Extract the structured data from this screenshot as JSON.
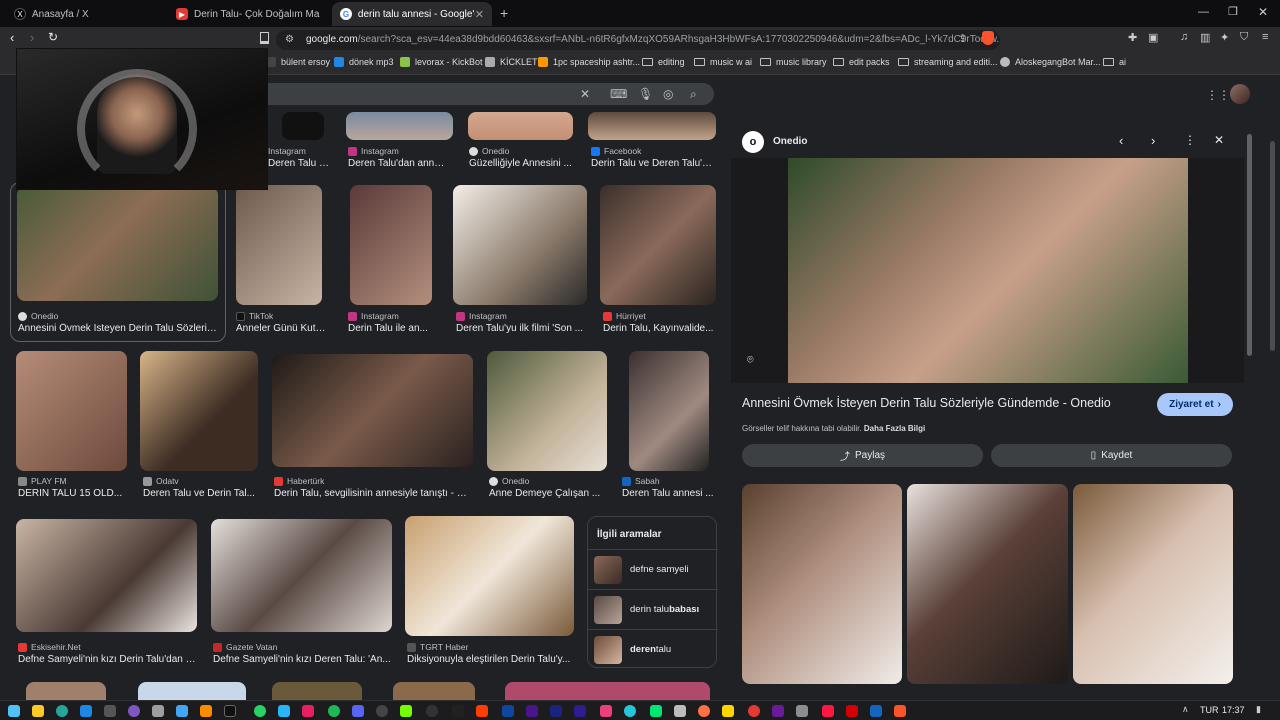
{
  "tabs": [
    {
      "title": "Anasayfa / X",
      "icon": "x-icon"
    },
    {
      "title": "Derin Talu- Çok Doğalım Makyajı - Yo",
      "icon": "youtube-icon"
    },
    {
      "title": "derin talu annesi - Google'da Ar",
      "icon": "google-icon"
    }
  ],
  "address": {
    "host": "google.com",
    "path": "/search?sca_esv=44ea38d9bdd60463&sxsrf=ANbL-n6tR6gfxMzqXO59ARhsgaH3HbWFsA:1770302250946&udm=2&fbs=ADc_l-Yk7dC9rTocjjw..."
  },
  "bookmarks": [
    {
      "label": "bülent ersoy",
      "type": "site",
      "color": "#444"
    },
    {
      "label": "dönek mp3",
      "type": "site",
      "color": "#1e88e5"
    },
    {
      "label": "levorax - KickBot",
      "type": "site",
      "color": "#8bc34a"
    },
    {
      "label": "KİCKLET",
      "type": "site",
      "color": "#aaa"
    },
    {
      "label": "1pc spaceship ashtr...",
      "type": "site",
      "color": "#ff9800"
    },
    {
      "label": "editing",
      "type": "folder"
    },
    {
      "label": "music w ai",
      "type": "folder"
    },
    {
      "label": "music library",
      "type": "folder"
    },
    {
      "label": "edit packs",
      "type": "folder"
    },
    {
      "label": "streaming and editi...",
      "type": "folder"
    },
    {
      "label": "AloskegangBot Mar...",
      "type": "site",
      "color": "#bbb"
    },
    {
      "label": "ai",
      "type": "folder"
    }
  ],
  "row0": [
    {
      "source": "Instagram",
      "title": "Deren Talu v..."
    },
    {
      "source": "Instagram",
      "title": "Deren Talu'dan anne..."
    },
    {
      "source": "Onedio",
      "title": "Güzelliğiyle Annesini ..."
    },
    {
      "source": "Facebook",
      "title": "Derin Talu ve Deren Talu'n..."
    }
  ],
  "row1": [
    {
      "source": "Onedio",
      "title": "Annesini Övmek İsteyen Derin Talu Sözleriyl..."
    },
    {
      "source": "TikTok",
      "title": "Anneler Günü Kutl..."
    },
    {
      "source": "Instagram",
      "title": "Derin Talu ile an..."
    },
    {
      "source": "Instagram",
      "title": "Deren Talu'yu ilk filmi 'Son ..."
    },
    {
      "source": "Hürriyet",
      "title": "Derin Talu, Kayınvalide..."
    }
  ],
  "row2": [
    {
      "source": "PLAY FM",
      "title": "DERİN TALU 15 OLD..."
    },
    {
      "source": "Odatv",
      "title": "Deren Talu ve Derin Tal..."
    },
    {
      "source": "Habertürk",
      "title": "Derin Talu, sevgilisinin annesiyle tanıştı - M..."
    },
    {
      "source": "Onedio",
      "title": "Anne Demeye Çalışan ..."
    },
    {
      "source": "Sabah",
      "title": "Deren Talu annesi ..."
    }
  ],
  "row3": [
    {
      "source": "Eskisehir.Net",
      "title": "Defne Samyeli'nin kızı Derin Talu'dan s..."
    },
    {
      "source": "Gazete Vatan",
      "title": "Defne Samyeli'nin kızı Deren Talu: 'An..."
    },
    {
      "source": "TGRT Haber",
      "title": "Diksiyonuyla eleştirilen Derin Talu'y..."
    }
  ],
  "related": {
    "heading": "İlgili aramalar",
    "items": [
      {
        "pre": "defne samyeli",
        "bold": ""
      },
      {
        "pre": "derin talu ",
        "bold": "babası"
      },
      {
        "pre": "",
        "bold": "deren",
        "post": " talu"
      }
    ]
  },
  "panel": {
    "site": "Onedio",
    "title": "Annesini Övmek İsteyen Derin Talu Sözleriyle Gündemde - Onedio",
    "visit": "Ziyaret et",
    "copyright": "Görseller telif hakkına tabi olabilir.",
    "more_info": "Daha Fazla Bilgi",
    "share": "Paylaş",
    "save": "Kaydet"
  },
  "taskbar": {
    "lang": "TUR",
    "time": "17:37"
  },
  "colors": {
    "google_blue": "#8ab4f8",
    "visit_btn": "#a8c7fa"
  }
}
